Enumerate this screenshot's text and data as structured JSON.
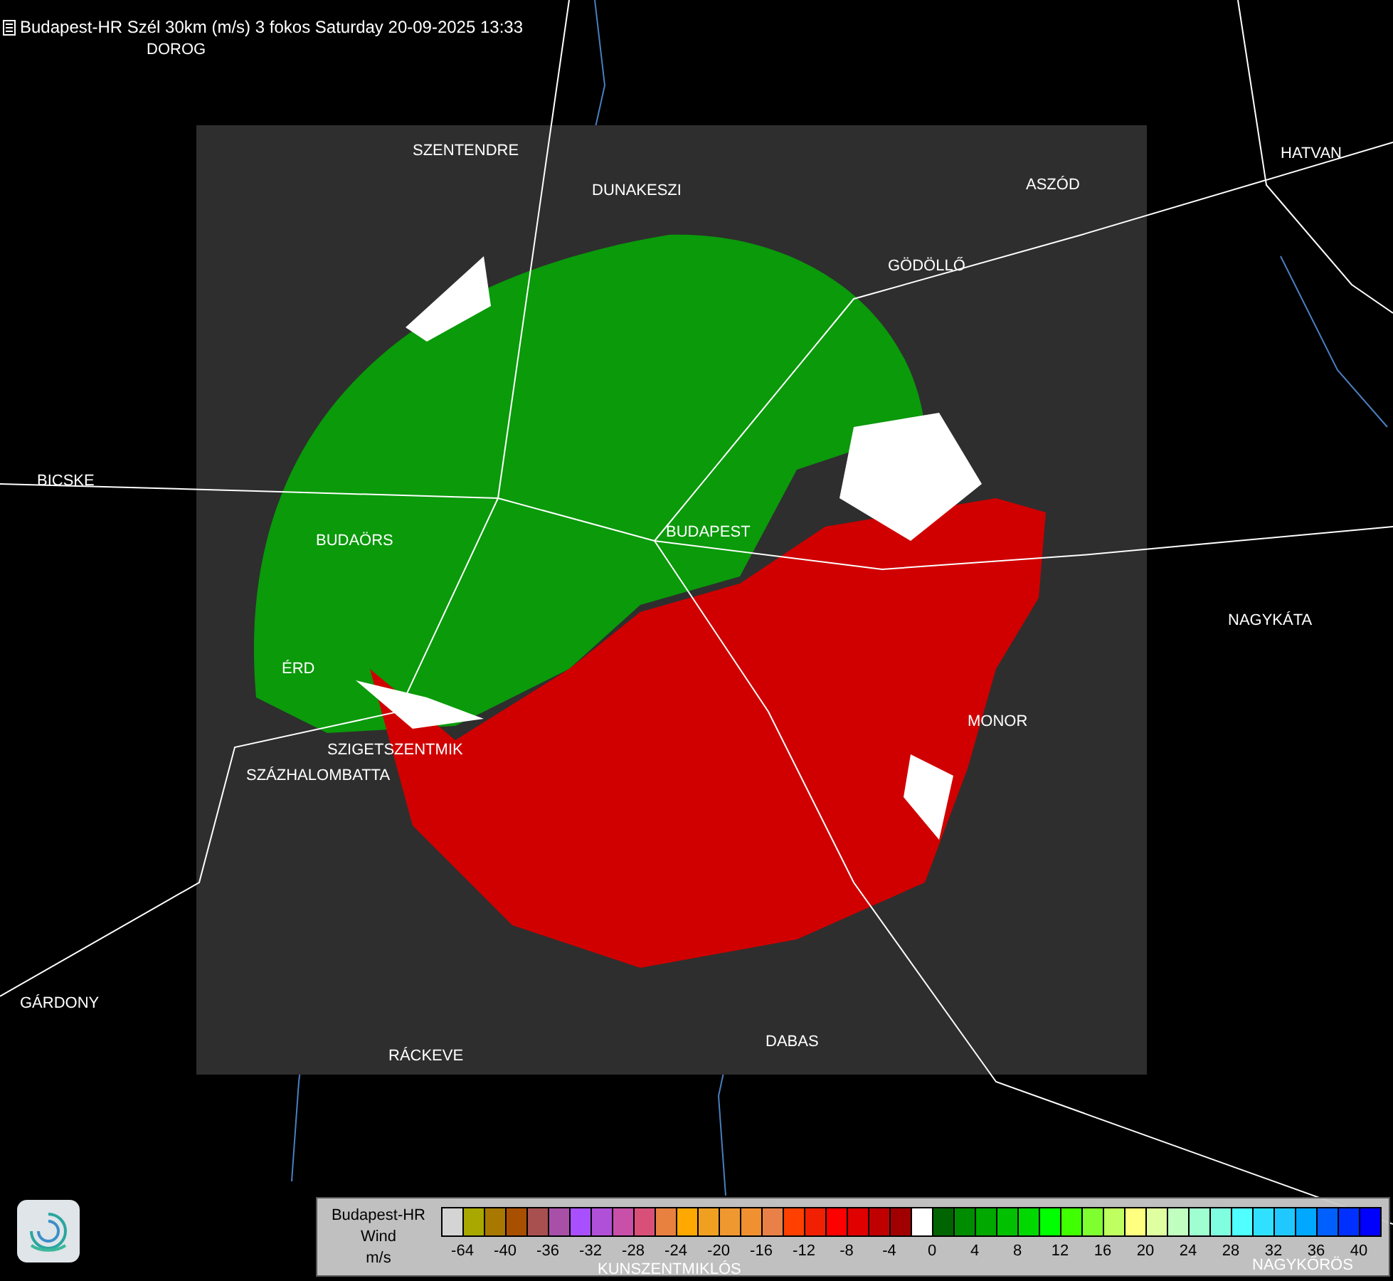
{
  "title": "Budapest-HR Szél 30km (m/s) 3 fokos Saturday 20-09-2025 13:33",
  "places": [
    "DOROG",
    "SZENTENDRE",
    "DUNAKESZI",
    "HATVAN",
    "ASZÓD",
    "GÖDÖLLŐ",
    "BICSKE",
    "BUDAÖRS",
    "BUDAPEST",
    "NAGYKÁTA",
    "ÉRD",
    "SZIGETSZENTMIK",
    "SZÁZHALOMBATTA",
    "MONOR",
    "GÁRDONY",
    "RÁCKEVE",
    "DABAS"
  ],
  "places_under_legend": [
    "KUNSZENTMIKLÓS",
    "NAGYKŐRÖS"
  ],
  "legend": {
    "title_lines": [
      "Budapest-HR",
      "Wind",
      "m/s"
    ],
    "swatches": [
      {
        "color": "#d4d4d4"
      },
      {
        "color": "#a8a800"
      },
      {
        "color": "#a87800"
      },
      {
        "color": "#a85000"
      },
      {
        "color": "#a85050"
      },
      {
        "color": "#a850a8"
      },
      {
        "color": "#a850ff"
      },
      {
        "color": "#b050d8"
      },
      {
        "color": "#c850a8"
      },
      {
        "color": "#d85078"
      },
      {
        "color": "#e88040"
      },
      {
        "color": "#ffa800"
      },
      {
        "color": "#f0a020"
      },
      {
        "color": "#f09830"
      },
      {
        "color": "#f09030"
      },
      {
        "color": "#e88048"
      },
      {
        "color": "#ff4000"
      },
      {
        "color": "#f02000"
      },
      {
        "color": "#ff0000"
      },
      {
        "color": "#e00000"
      },
      {
        "color": "#c00000"
      },
      {
        "color": "#a00000"
      },
      {
        "color": "#ffffff"
      },
      {
        "color": "#006400"
      },
      {
        "color": "#008c00"
      },
      {
        "color": "#00a800"
      },
      {
        "color": "#00c000"
      },
      {
        "color": "#00d800"
      },
      {
        "color": "#00ff00"
      },
      {
        "color": "#40ff00"
      },
      {
        "color": "#80ff30"
      },
      {
        "color": "#c0ff60"
      },
      {
        "color": "#ffff80"
      },
      {
        "color": "#e0ffa0"
      },
      {
        "color": "#c0ffc0"
      },
      {
        "color": "#a0ffd0"
      },
      {
        "color": "#80ffe0"
      },
      {
        "color": "#50ffff"
      },
      {
        "color": "#30e0ff"
      },
      {
        "color": "#20c8ff"
      },
      {
        "color": "#00a8ff"
      },
      {
        "color": "#0060ff"
      },
      {
        "color": "#0030ff"
      },
      {
        "color": "#0000ff"
      }
    ],
    "ticks": [
      "-64",
      "-40",
      "-36",
      "-32",
      "-28",
      "-24",
      "-20",
      "-16",
      "-12",
      "-8",
      "-4",
      "0",
      "4",
      "8",
      "12",
      "16",
      "20",
      "24",
      "28",
      "32",
      "36",
      "40"
    ]
  }
}
